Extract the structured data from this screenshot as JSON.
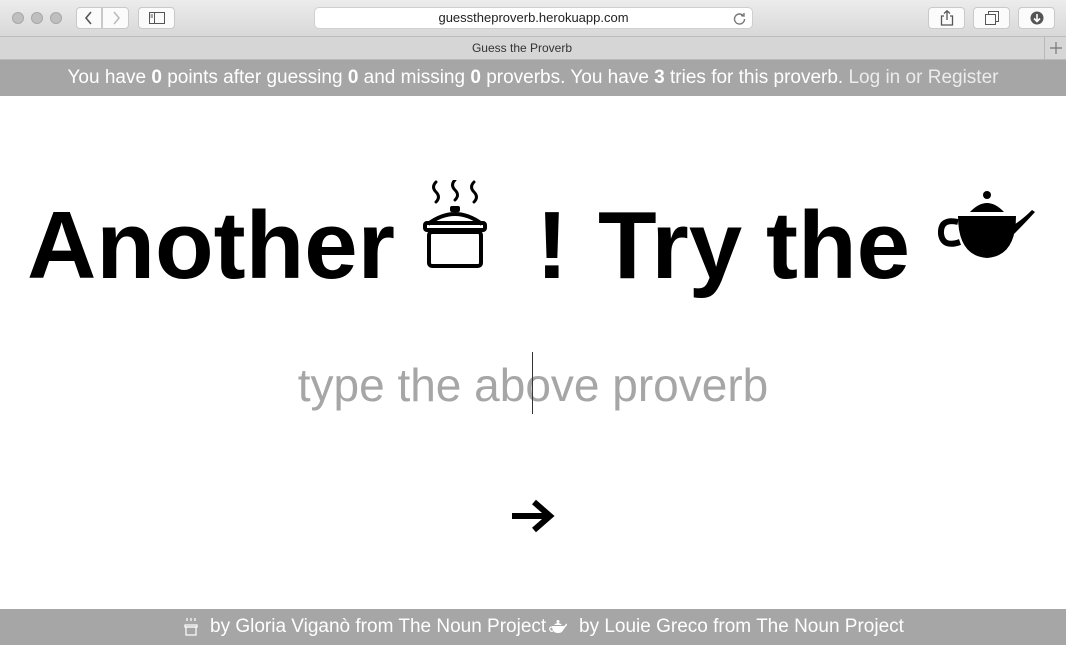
{
  "browser": {
    "url": "guesstheproverb.herokuapp.com",
    "tab_title": "Guess the Proverb"
  },
  "status": {
    "prefix": "You have",
    "points": "0",
    "after_points": "points after guessing",
    "guessed": "0",
    "and_missing": "and missing",
    "missed": "0",
    "after_missed": "proverbs. You have",
    "tries": "3",
    "after_tries": "tries for this proverb.",
    "login": "Log in",
    "or": "or",
    "register": "Register"
  },
  "puzzle": {
    "word_1": "Another",
    "word_2": "!",
    "word_3": "Try",
    "word_4": "the",
    "image_1": "pot-icon",
    "image_2": "teapot-icon"
  },
  "answer": {
    "placeholder": "type the above proverb",
    "value": "",
    "submit_icon": "arrow-right-icon"
  },
  "footer": {
    "credit_1": "by Gloria Viganò from The Noun Project",
    "credit_2": "by Louie Greco from The Noun Project"
  }
}
